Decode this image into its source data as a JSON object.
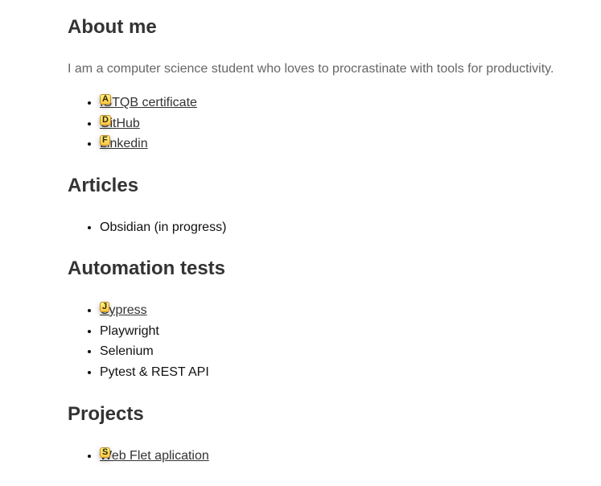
{
  "about": {
    "heading": "About me",
    "intro": "I am a computer science student who loves to procrastinate with tools for productivity.",
    "links": [
      {
        "hint": "A",
        "label": "ISTQB certificate"
      },
      {
        "hint": "D",
        "label": "GitHub"
      },
      {
        "hint": "F",
        "label": "Linkedin"
      }
    ]
  },
  "articles": {
    "heading": "Articles",
    "items": [
      "Obsidian (in progress)"
    ]
  },
  "automation": {
    "heading": "Automation tests",
    "items": [
      {
        "hint": "J",
        "label": "Cypress"
      },
      {
        "label": "Playwright"
      },
      {
        "label": "Selenium"
      },
      {
        "label": "Pytest & REST API"
      }
    ]
  },
  "projects": {
    "heading": "Projects",
    "items": [
      {
        "hint": "S",
        "label": "Web Flet aplication"
      }
    ]
  },
  "colors": {
    "hint_background": "#ffd84a",
    "hint_border": "#c38a22",
    "heading": "#333333",
    "intro_text": "#666666"
  }
}
